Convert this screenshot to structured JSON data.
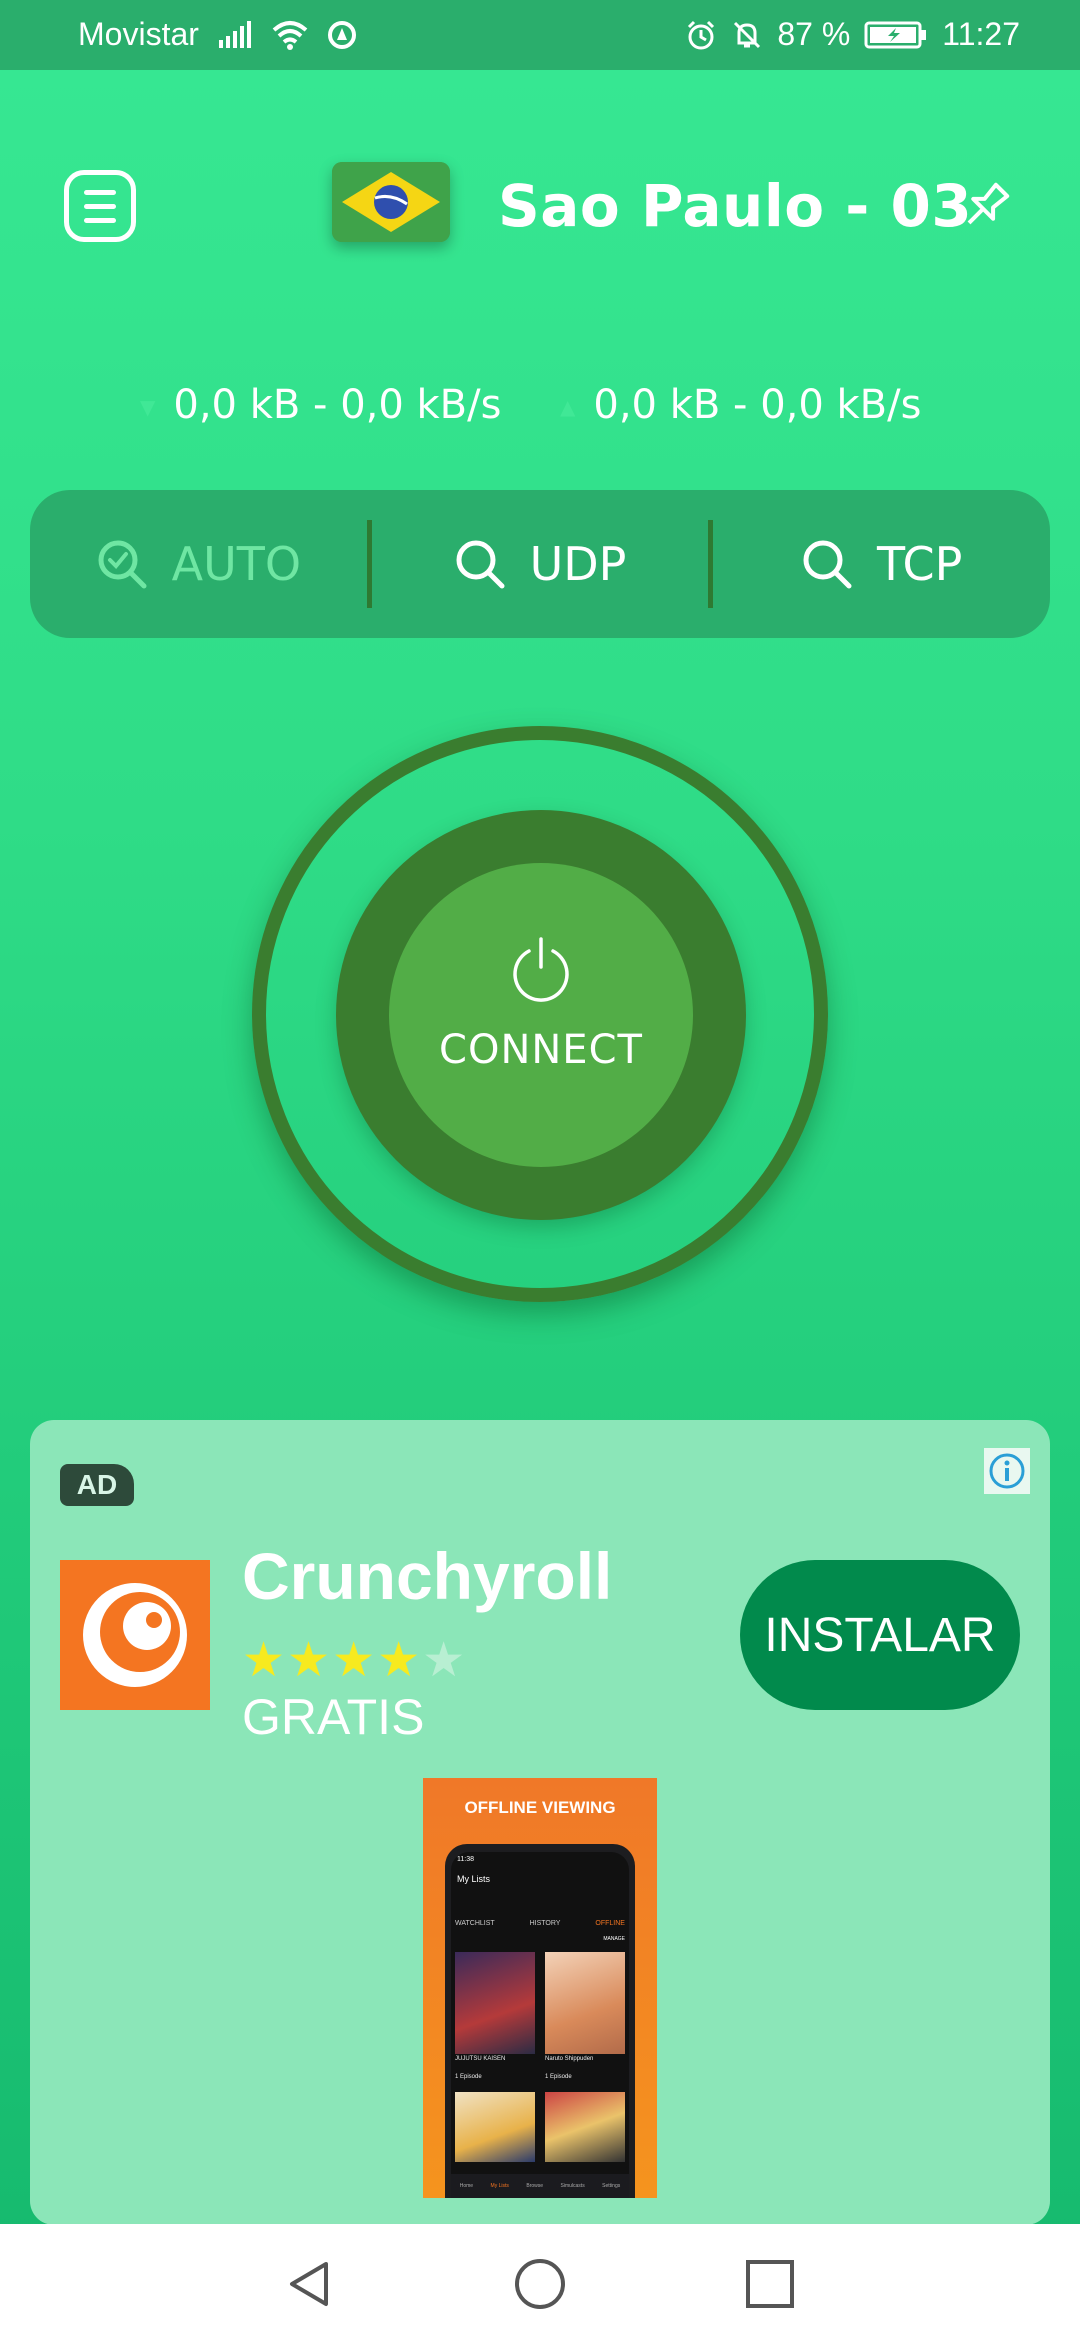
{
  "status_bar": {
    "carrier": "Movistar",
    "battery": "87 %",
    "time": "11:27"
  },
  "header": {
    "server_name": "Sao Paulo - 03",
    "flag": "brazil-flag"
  },
  "traffic": {
    "download": "0,0 kB - 0,0 kB/s",
    "upload": "0,0 kB - 0,0 kB/s"
  },
  "protocols": [
    {
      "label": "AUTO",
      "active": true
    },
    {
      "label": "UDP",
      "active": false
    },
    {
      "label": "TCP",
      "active": false
    }
  ],
  "connect": {
    "label": "CONNECT"
  },
  "ad": {
    "badge": "AD",
    "app_name": "Crunchyroll",
    "rating": 4,
    "rating_max": 5,
    "price": "GRATIS",
    "install_label": "INSTALAR",
    "screenshot": {
      "title": "OFFLINE VIEWING",
      "time": "11:38",
      "heading": "My Lists",
      "tabs": [
        "WATCHLIST",
        "HISTORY",
        "OFFLINE"
      ],
      "manage": "MANAGE",
      "items": [
        {
          "title": "JUJUTSU KAISEN",
          "count": "1 Episode"
        },
        {
          "title": "Naruto Shippuden",
          "count": "1 Episode"
        }
      ],
      "nav": [
        "Home",
        "My Lists",
        "Browse",
        "Simulcasts",
        "Settings"
      ]
    }
  },
  "colors": {
    "background_top": "#37e893",
    "status_bar": "#2aae6c",
    "ring": "#3a7d2f",
    "connect_fill": "#52ad47",
    "ad_background": "#8be6b8",
    "install_button": "#018a4c",
    "crunchyroll_orange": "#f47521"
  }
}
